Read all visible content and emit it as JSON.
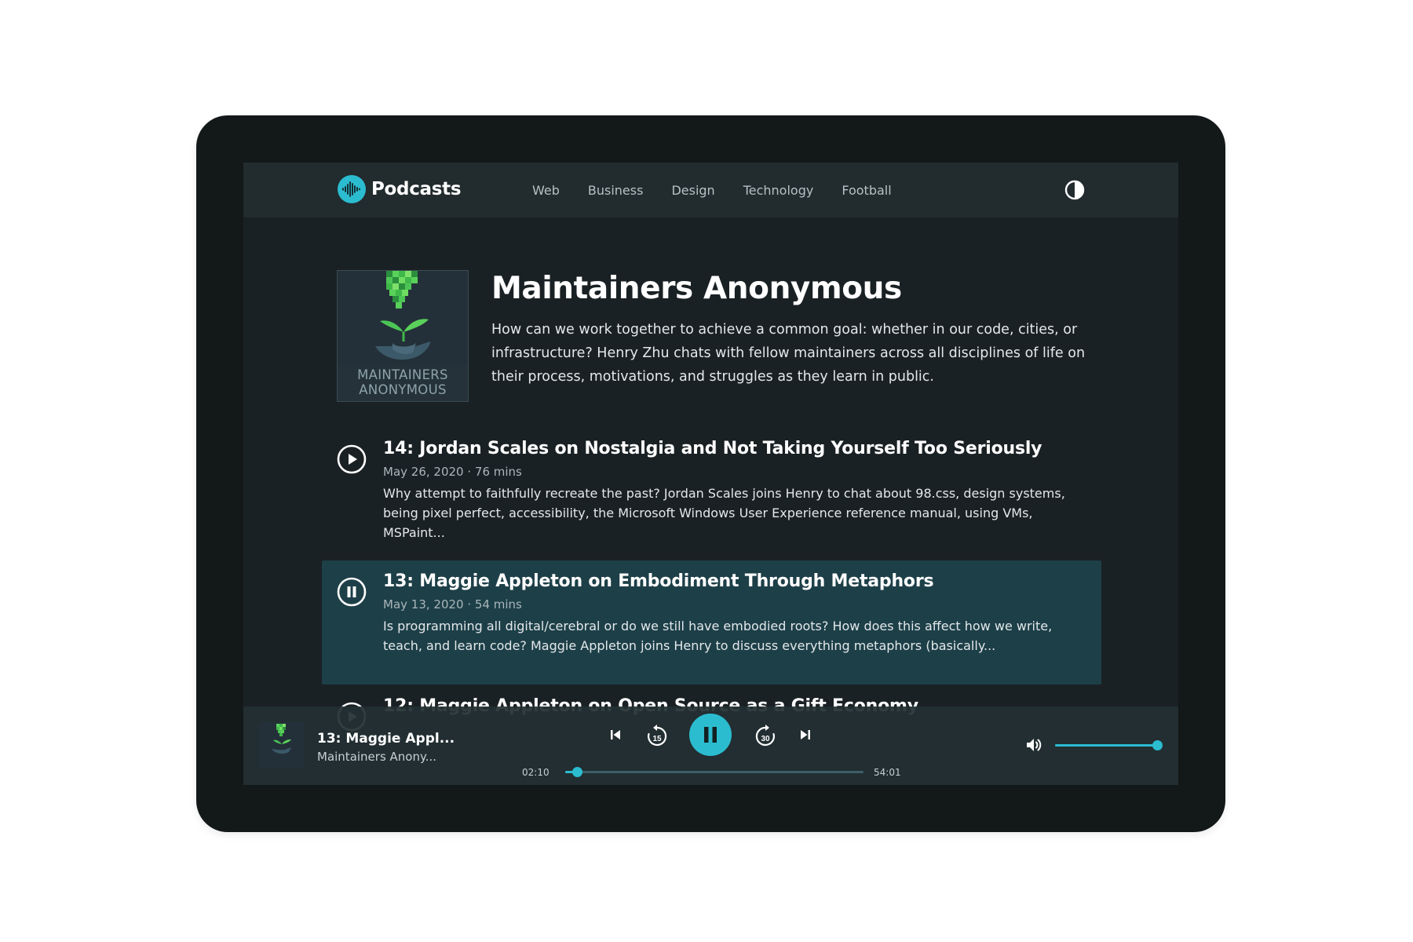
{
  "header": {
    "brand": "Podcasts",
    "nav": [
      "Web",
      "Business",
      "Design",
      "Technology",
      "Football"
    ]
  },
  "podcast": {
    "cover_line1": "MAINTAINERS",
    "cover_line2": "ANONYMOUS",
    "title": "Maintainers Anonymous",
    "description": "How can we work together to achieve a common goal: whether in our code, cities, or infrastructure? Henry Zhu chats with fellow maintainers across all disciplines of life on their process, motivations, and struggles as they learn in public."
  },
  "episodes": [
    {
      "title": "14: Jordan Scales on Nostalgia and Not Taking Yourself Too Seriously",
      "date": "May 26, 2020",
      "duration": "76 mins",
      "description": "Why attempt to faithfully recreate the past? Jordan Scales joins Henry to chat about 98.css, design systems, being pixel perfect, accessibility, the Microsoft Windows User Experience reference manual, using VMs, MSPaint...",
      "state": "paused"
    },
    {
      "title": "13: Maggie Appleton on Embodiment Through Metaphors",
      "date": "May 13, 2020",
      "duration": "54 mins",
      "description": "Is programming all digital/cerebral or do we still have embodied roots? How does this affect how we write, teach, and learn code? Maggie Appleton joins Henry to discuss everything metaphors (basically...",
      "state": "playing"
    },
    {
      "title": "12: Maggie Appleton on Open Source as a Gift Economy",
      "date": "",
      "duration": "",
      "description": "",
      "state": "paused"
    }
  ],
  "player": {
    "title": "13: Maggie Appl...",
    "subtitle": "Maintainers Anony...",
    "elapsed": "02:10",
    "duration": "54:01",
    "progress": 0.04,
    "volume": 1.0,
    "skip_back": "15",
    "skip_forward": "30"
  },
  "colors": {
    "accent": "#2bbcd0",
    "background": "#1a2124",
    "active_row": "#1d3f48"
  }
}
